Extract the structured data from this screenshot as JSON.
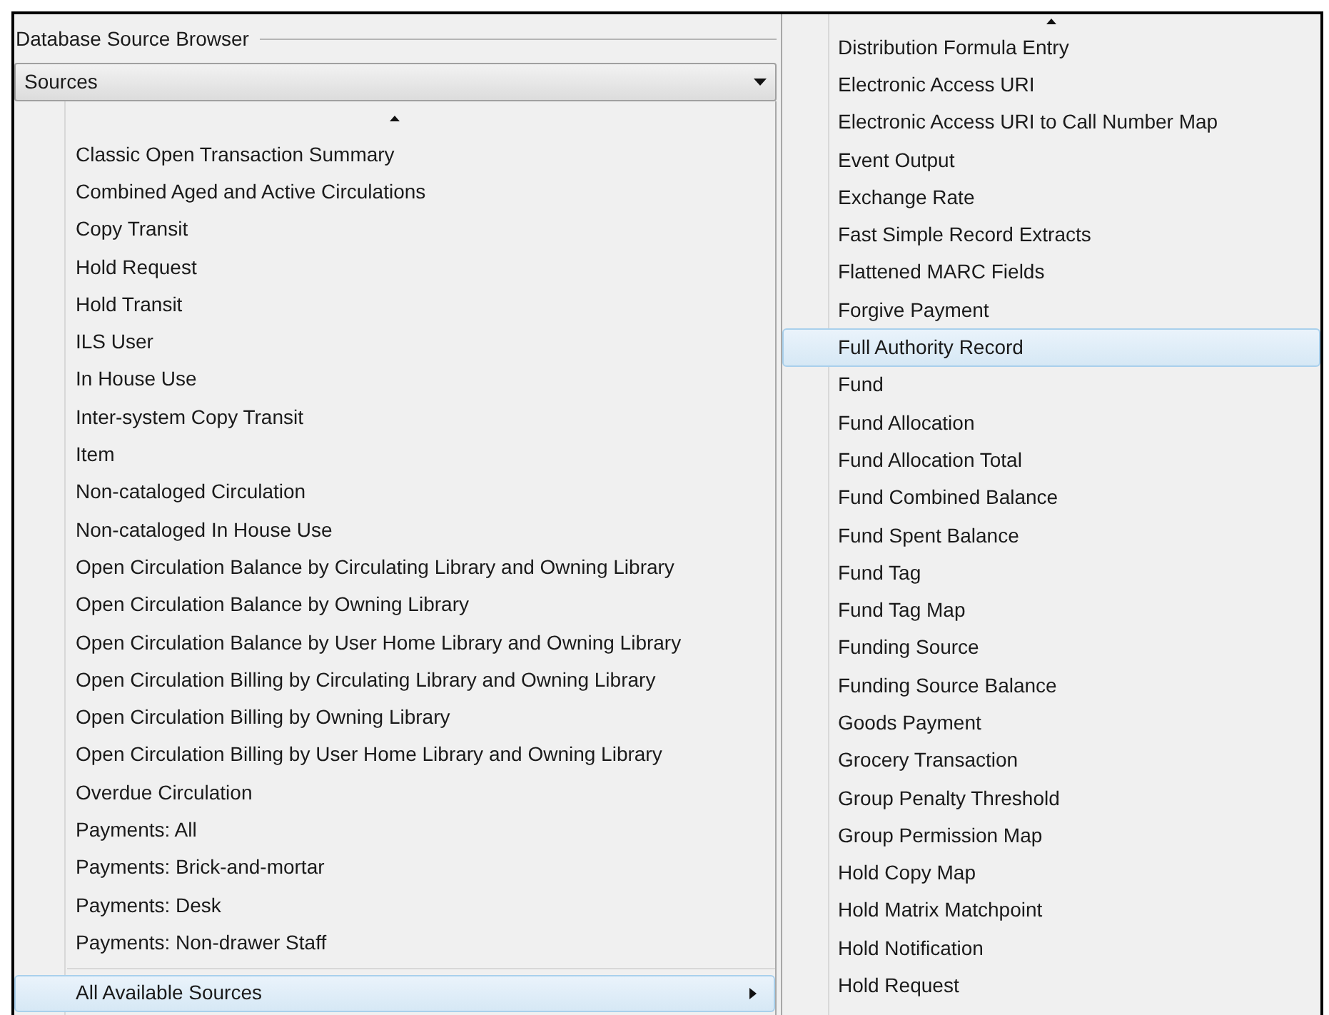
{
  "panel": {
    "title": "Database Source Browser"
  },
  "dropdown": {
    "value": "Sources"
  },
  "menu": {
    "items": [
      {
        "label": "Classic Open Transaction Summary",
        "kind": "item",
        "selected": false
      },
      {
        "label": "Combined Aged and Active Circulations",
        "kind": "item",
        "selected": false
      },
      {
        "label": "Copy Transit",
        "kind": "item",
        "selected": false
      },
      {
        "label": "Hold Request",
        "kind": "item",
        "selected": false
      },
      {
        "label": "Hold Transit",
        "kind": "item",
        "selected": false
      },
      {
        "label": "ILS User",
        "kind": "item",
        "selected": false
      },
      {
        "label": "In House Use",
        "kind": "item",
        "selected": false
      },
      {
        "label": "Inter-system Copy Transit",
        "kind": "item",
        "selected": false
      },
      {
        "label": "Item",
        "kind": "item",
        "selected": false
      },
      {
        "label": "Non-cataloged Circulation",
        "kind": "item",
        "selected": false
      },
      {
        "label": "Non-cataloged In House Use",
        "kind": "item",
        "selected": false
      },
      {
        "label": "Open Circulation Balance by Circulating Library and Owning Library",
        "kind": "item",
        "selected": false
      },
      {
        "label": "Open Circulation Balance by Owning Library",
        "kind": "item",
        "selected": false
      },
      {
        "label": "Open Circulation Balance by User Home Library and Owning Library",
        "kind": "item",
        "selected": false
      },
      {
        "label": "Open Circulation Billing by Circulating Library and Owning Library",
        "kind": "item",
        "selected": false
      },
      {
        "label": "Open Circulation Billing by Owning Library",
        "kind": "item",
        "selected": false
      },
      {
        "label": "Open Circulation Billing by User Home Library and Owning Library",
        "kind": "item",
        "selected": false
      },
      {
        "label": "Overdue Circulation",
        "kind": "item",
        "selected": false
      },
      {
        "label": "Payments: All",
        "kind": "item",
        "selected": false
      },
      {
        "label": "Payments: Brick-and-mortar",
        "kind": "item",
        "selected": false
      },
      {
        "label": "Payments: Desk",
        "kind": "item",
        "selected": false
      },
      {
        "label": "Payments: Non-drawer Staff",
        "kind": "item",
        "selected": false
      },
      {
        "label": "All Available Sources",
        "kind": "submenu",
        "selected": true
      }
    ]
  },
  "submenu": {
    "items": [
      {
        "label": "Distribution Formula Entry",
        "selected": false
      },
      {
        "label": "Electronic Access URI",
        "selected": false
      },
      {
        "label": "Electronic Access URI to Call Number Map",
        "selected": false
      },
      {
        "label": "Event Output",
        "selected": false
      },
      {
        "label": "Exchange Rate",
        "selected": false
      },
      {
        "label": "Fast Simple Record Extracts",
        "selected": false
      },
      {
        "label": "Flattened MARC Fields",
        "selected": false
      },
      {
        "label": "Forgive Payment",
        "selected": false
      },
      {
        "label": "Full Authority Record",
        "selected": true
      },
      {
        "label": "Fund",
        "selected": false
      },
      {
        "label": "Fund Allocation",
        "selected": false
      },
      {
        "label": "Fund Allocation Total",
        "selected": false
      },
      {
        "label": "Fund Combined Balance",
        "selected": false
      },
      {
        "label": "Fund Spent Balance",
        "selected": false
      },
      {
        "label": "Fund Tag",
        "selected": false
      },
      {
        "label": "Fund Tag Map",
        "selected": false
      },
      {
        "label": "Funding Source",
        "selected": false
      },
      {
        "label": "Funding Source Balance",
        "selected": false
      },
      {
        "label": "Goods Payment",
        "selected": false
      },
      {
        "label": "Grocery Transaction",
        "selected": false
      },
      {
        "label": "Group Penalty Threshold",
        "selected": false
      },
      {
        "label": "Group Permission Map",
        "selected": false
      },
      {
        "label": "Hold Copy Map",
        "selected": false
      },
      {
        "label": "Hold Matrix Matchpoint",
        "selected": false
      },
      {
        "label": "Hold Notification",
        "selected": false
      },
      {
        "label": "Hold Request",
        "selected": false
      }
    ]
  }
}
